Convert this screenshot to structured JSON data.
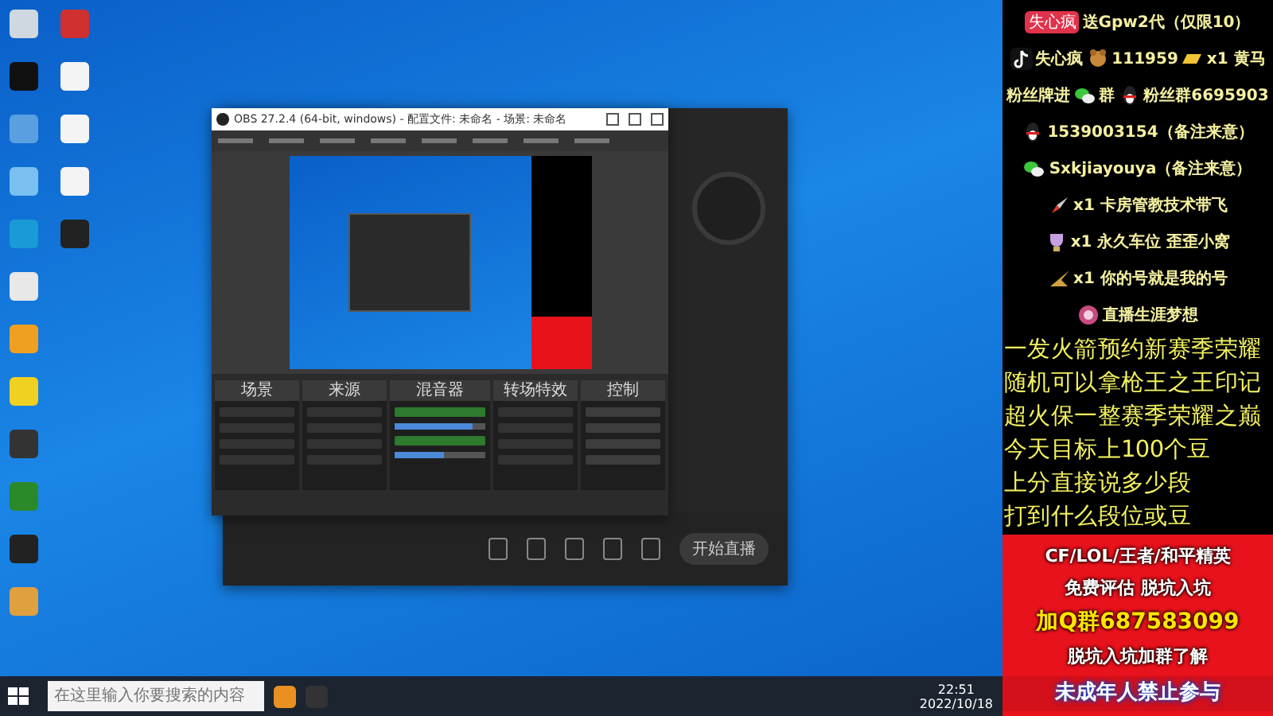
{
  "obs_window": {
    "title": "OBS 27.2.4 (64-bit, windows) - 配置文件: 未命名 - 场景: 未命名",
    "docks": [
      {
        "title": "场景"
      },
      {
        "title": "来源"
      },
      {
        "title": "混音器"
      },
      {
        "title": "转场特效"
      },
      {
        "title": "控制"
      }
    ],
    "mixer": [
      {
        "level": 0.85
      },
      {
        "level": 0.55
      }
    ]
  },
  "stream_app": {
    "go_live": "开始直播"
  },
  "taskbar": {
    "search": {
      "placeholder": "在这里输入你要搜索的内容"
    },
    "time": "22:51",
    "date": "2022/10/18"
  },
  "overlay": {
    "gift_rows": [
      {
        "parts": [
          {
            "kind": "badge",
            "text": "失心疯"
          },
          {
            "kind": "text",
            "text": "送Gpw2代（仅限10）"
          }
        ]
      },
      {
        "parts": [
          {
            "kind": "douyin"
          },
          {
            "kind": "text",
            "text": "失心疯"
          },
          {
            "kind": "bear"
          },
          {
            "kind": "text",
            "text": "111959"
          },
          {
            "kind": "gold"
          },
          {
            "kind": "text",
            "text": "x1 黄马"
          }
        ]
      },
      {
        "parts": [
          {
            "kind": "text",
            "text": "粉丝牌进"
          },
          {
            "kind": "wechat"
          },
          {
            "kind": "text",
            "text": "群"
          },
          {
            "kind": "qq"
          },
          {
            "kind": "text",
            "text": "粉丝群6695903"
          }
        ]
      },
      {
        "parts": [
          {
            "kind": "qq"
          },
          {
            "kind": "text",
            "text": "1539003154（备注来意）"
          }
        ]
      },
      {
        "parts": [
          {
            "kind": "wechat"
          },
          {
            "kind": "text",
            "text": "Sxkjiayouya（备注来意）"
          }
        ]
      },
      {
        "parts": [
          {
            "kind": "rocket"
          },
          {
            "kind": "text",
            "text": "x1 卡房管教技术带飞"
          }
        ]
      },
      {
        "parts": [
          {
            "kind": "trophy"
          },
          {
            "kind": "text",
            "text": "x1 永久车位 歪歪小窝"
          }
        ]
      },
      {
        "parts": [
          {
            "kind": "plane"
          },
          {
            "kind": "text",
            "text": "x1 你的号就是我的号"
          }
        ]
      },
      {
        "parts": [
          {
            "kind": "medal"
          },
          {
            "kind": "text",
            "text": "直播生涯梦想"
          }
        ]
      }
    ],
    "big_lines": [
      "一发火箭预约新赛季荣耀",
      "随机可以拿枪王之王印记",
      "超火保一整赛季荣耀之巅",
      "今天目标上100个豆",
      "上分直接说多少段",
      "打到什么段位或豆"
    ],
    "promo_lines": [
      {
        "text": "CF/LOL/王者/和平精英",
        "kind": "white"
      },
      {
        "text": "免费评估 脱坑入坑",
        "kind": "white"
      },
      {
        "text": "加Q群687583099",
        "kind": "yellow"
      },
      {
        "text": "脱坑入坑加群了解",
        "kind": "white"
      }
    ],
    "footer": "未成年人禁止参与"
  }
}
